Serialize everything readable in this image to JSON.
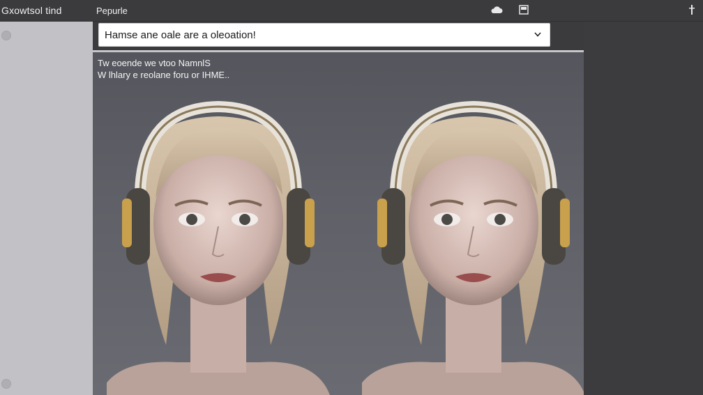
{
  "topbar": {
    "app_title": "Gxowtsol tind",
    "menu_label": "Pepurle",
    "icons": [
      "cloud-icon",
      "window-icon",
      "info-icon"
    ]
  },
  "prompt": {
    "value": "Hamse ane oale are a oleoation!",
    "dropdown_icon": "chevron-down-icon"
  },
  "caption": {
    "line1": "Tw eoende we vtoo NamnlS",
    "line2": "W lhlary e reolane foru or IHME.."
  },
  "colors": {
    "background": "#3a3a3d",
    "sidebar": "#c2c2c6",
    "prompt_field": "#ffffff"
  }
}
